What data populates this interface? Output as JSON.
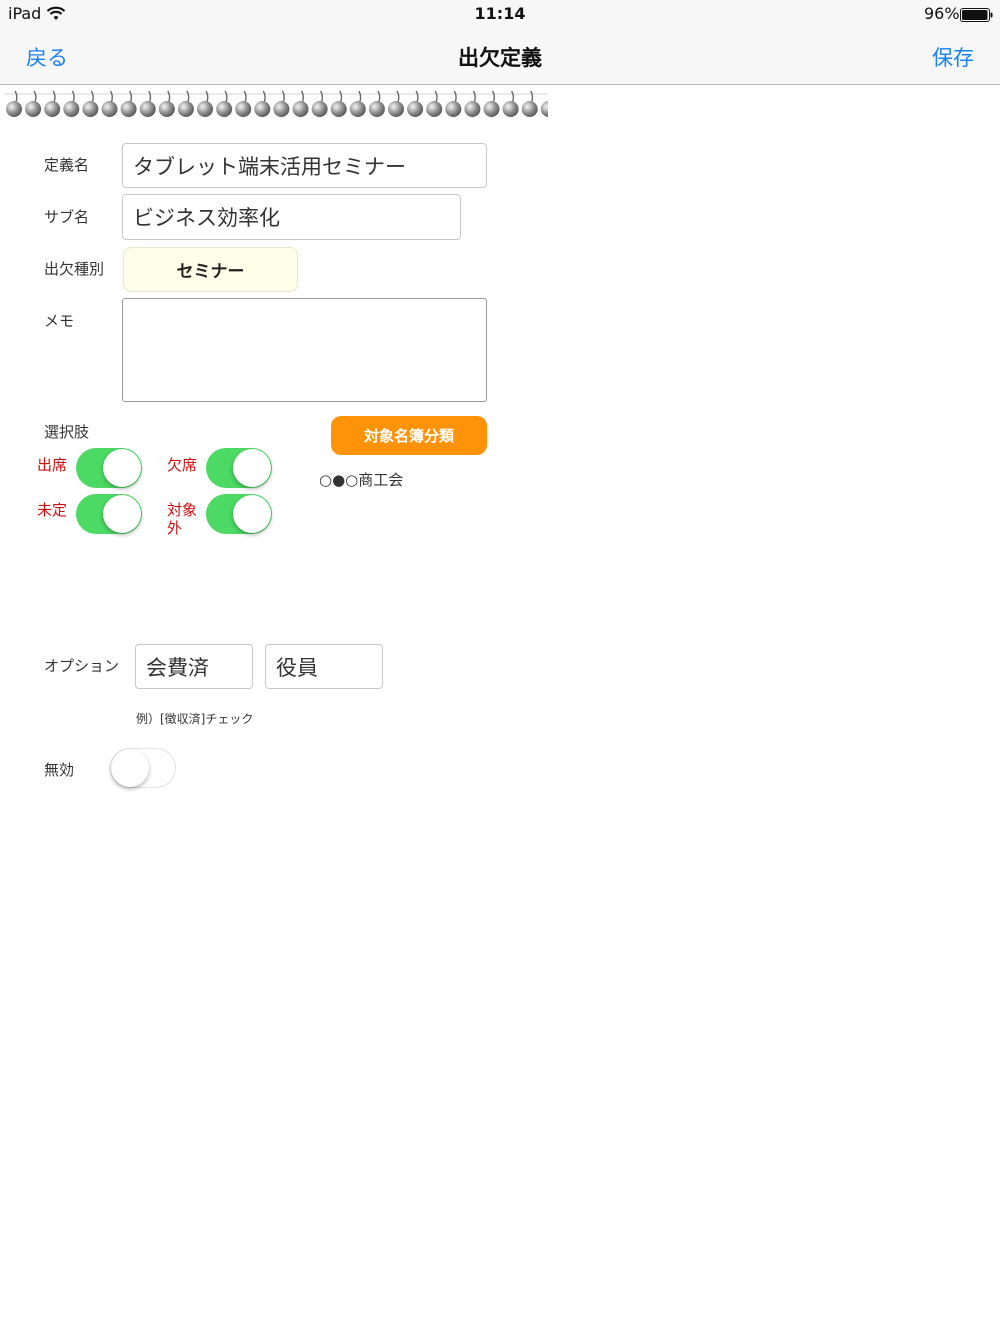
{
  "status_bar": {
    "device": "iPad",
    "time": "11:14",
    "battery": "96%",
    "wifi_icon": "wifi-icon",
    "battery_icon": "battery-icon"
  },
  "nav": {
    "back_label": "戻る",
    "title": "出欠定義",
    "save_label": "保存",
    "accent_color": "#1a82f7"
  },
  "form": {
    "definition_name": {
      "label": "定義名",
      "value": "タブレット端末活用セミナー"
    },
    "sub_name": {
      "label": "サブ名",
      "value": "ビジネス効率化"
    },
    "attendance_type": {
      "label": "出欠種別",
      "value": "セミナー"
    },
    "memo": {
      "label": "メモ",
      "value": ""
    },
    "choices": {
      "label": "選択肢",
      "items": [
        {
          "label": "出席",
          "on": true
        },
        {
          "label": "欠席",
          "on": true
        },
        {
          "label": "未定",
          "on": true
        },
        {
          "label": "対象外",
          "on": true
        }
      ]
    },
    "category_button": {
      "label": "対象名簿分類",
      "color": "#ff9307"
    },
    "category_value": "○●○商工会",
    "options": {
      "label": "オプション",
      "values": [
        "会費済",
        "役員"
      ],
      "hint": "例）[徴収済]チェック"
    },
    "disabled": {
      "label": "無効",
      "on": false
    }
  }
}
